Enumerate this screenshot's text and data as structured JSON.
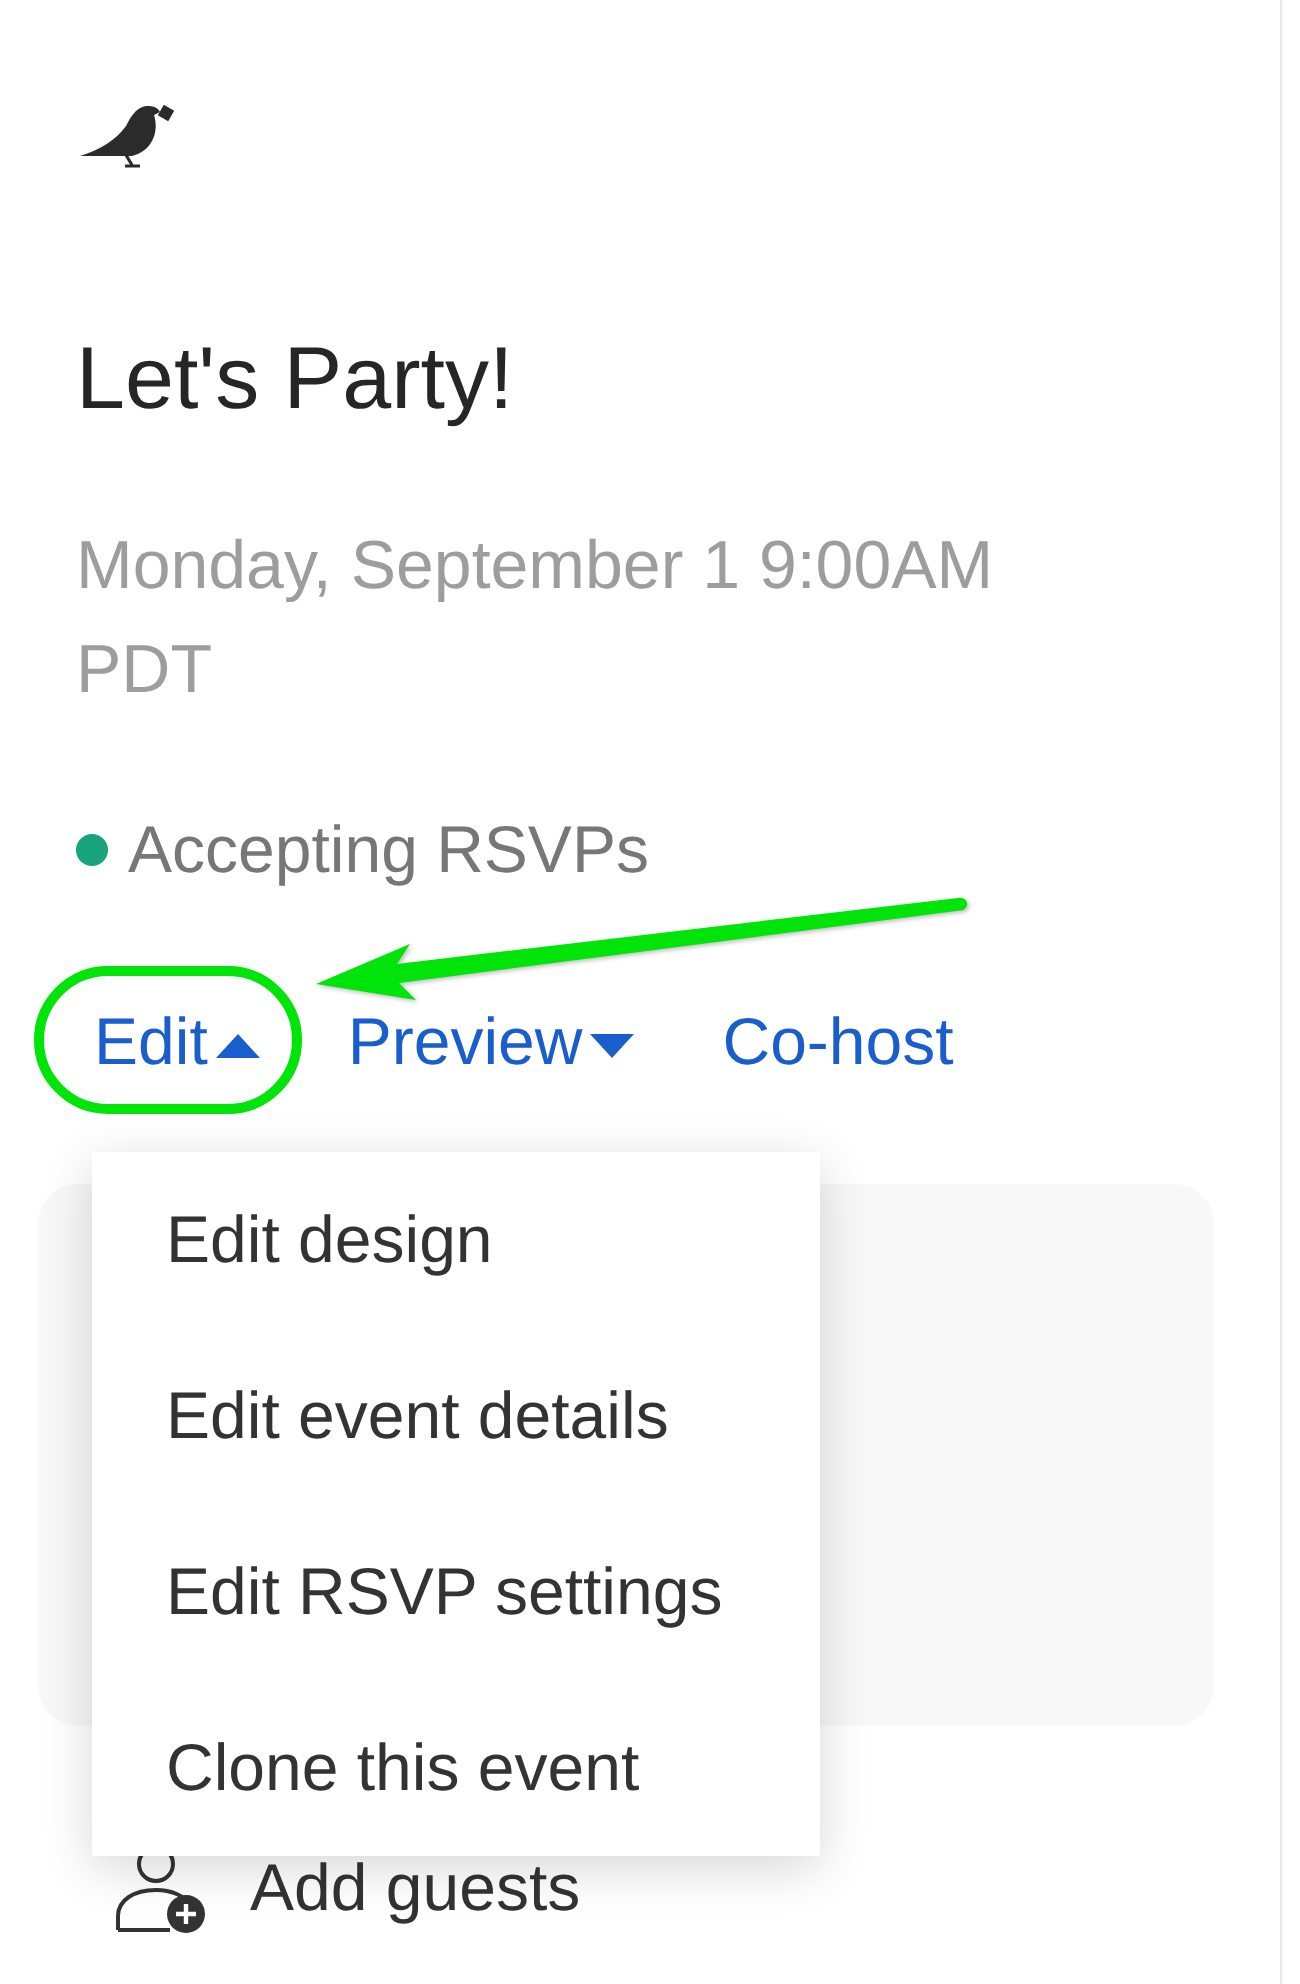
{
  "event": {
    "title": "Let's Party!",
    "datetime": "Monday, September 1 9:00AM PDT",
    "status": "Accepting RSVPs"
  },
  "actions": [
    {
      "label": "Edit",
      "kind": "dropdown",
      "expanded": true,
      "highlighted": true,
      "menu": [
        "Edit design",
        "Edit event details",
        "Edit RSVP settings",
        "Clone this event"
      ]
    },
    {
      "label": "Preview",
      "kind": "dropdown",
      "expanded": false,
      "highlighted": false
    },
    {
      "label": "Co-host",
      "kind": "link",
      "highlighted": false
    }
  ],
  "add_guests": {
    "label": "Add guests"
  }
}
